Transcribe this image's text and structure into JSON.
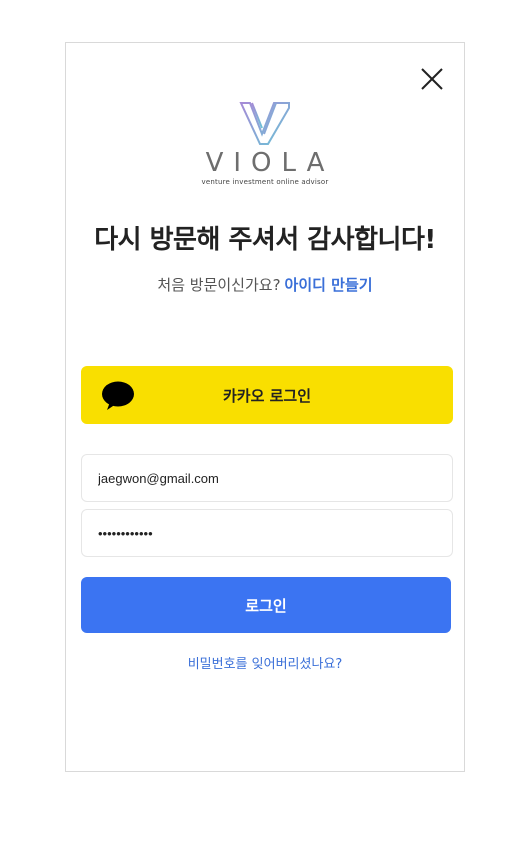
{
  "logo": {
    "wordmark": "VIOLA",
    "tagline": "venture investment online advisor"
  },
  "heading": "다시 방문해 주셔서 감사합니다!",
  "signup_prompt": {
    "text": "처음 방문이신가요?",
    "link": "아이디 만들기"
  },
  "kakao_login": {
    "label": "카카오 로그인",
    "color": "#f9df00"
  },
  "email_field": {
    "value": "jaegwon@gmail.com"
  },
  "password_field": {
    "value": "••••••••••••"
  },
  "login_button": {
    "label": "로그인",
    "color": "#3b74f2"
  },
  "forgot_password": "비밀번호를 잊어버리셨나요?",
  "colors": {
    "accent_link": "#3a6fd8",
    "border": "#d9d9d9"
  },
  "icons": [
    "close-icon",
    "viola-logo-icon",
    "kakao-chat-icon"
  ]
}
